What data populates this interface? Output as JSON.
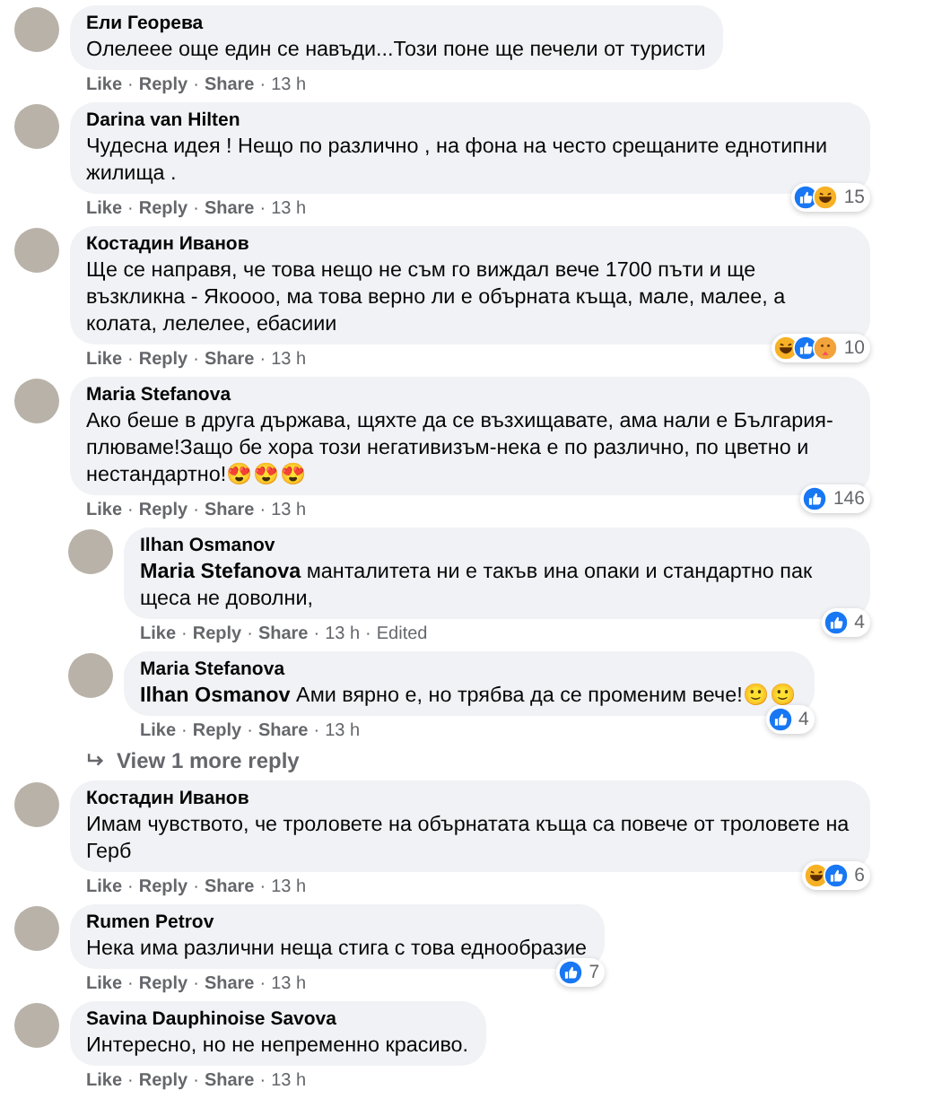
{
  "separator": "·",
  "comments": [
    {
      "author": "Ели Георева",
      "text": "Олелеее още един се навъди...Този поне ще печели от туристи",
      "actions": [
        "Like",
        "Reply",
        "Share"
      ],
      "time": "13 h"
    },
    {
      "author": "Darina van Hilten",
      "text": "Чудесна идея ! Нещо по различно , на фона на често срещаните еднотипни жилища .",
      "actions": [
        "Like",
        "Reply",
        "Share"
      ],
      "time": "13 h",
      "reactions": [
        {
          "kind": "like"
        },
        {
          "kind": "haha"
        }
      ],
      "reaction_count": "15"
    },
    {
      "author": "Костадин Иванов",
      "text": "Ще се направя, че това нещо не съм го виждал вече 1700 пъти и ще възкликна - Якоооо, ма това верно ли е обърната къща, мале, малее, а колата, лелелее, ебасиии",
      "actions": [
        "Like",
        "Reply",
        "Share"
      ],
      "time": "13 h",
      "reactions": [
        {
          "kind": "haha"
        },
        {
          "kind": "like"
        },
        {
          "kind": "care"
        }
      ],
      "reaction_count": "10"
    },
    {
      "author": "Maria Stefanova",
      "text": "Ако беше в друга държава, щяхте да се възхищавате, ама нали е България-плюваме!Защо бе хора този негативизъм-нека е по различно, по цветно и нестандартно!😍😍😍",
      "actions": [
        "Like",
        "Reply",
        "Share"
      ],
      "time": "13 h",
      "reactions": [
        {
          "kind": "like"
        }
      ],
      "reaction_count": "146",
      "replies": [
        {
          "author": "Ilhan Osmanov",
          "text": "**Maria Stefanova** манталитета ни е такъв ина опаки и стандартно пак щеса не доволни,",
          "actions": [
            "Like",
            "Reply",
            "Share"
          ],
          "time": "13 h",
          "edited": "Edited",
          "reactions": [
            {
              "kind": "like"
            }
          ],
          "reaction_count": "4"
        },
        {
          "author": "Maria Stefanova",
          "text": "**Ilhan Osmanov** Ами вярно е, но трябва да се променим вече!🙂🙂",
          "actions": [
            "Like",
            "Reply",
            "Share"
          ],
          "time": "13 h",
          "reactions": [
            {
              "kind": "like"
            }
          ],
          "reaction_count": "4"
        }
      ],
      "more_replies": "View 1 more reply"
    },
    {
      "author": "Костадин Иванов",
      "text": "Имам чувството, че троловете на обърнатата къща са повече от троловете на Герб",
      "actions": [
        "Like",
        "Reply",
        "Share"
      ],
      "time": "13 h",
      "reactions": [
        {
          "kind": "haha"
        },
        {
          "kind": "like"
        }
      ],
      "reaction_count": "6"
    },
    {
      "author": "Rumen Petrov",
      "text": "Нека има различни неща стига с това еднообразие",
      "actions": [
        "Like",
        "Reply",
        "Share"
      ],
      "time": "13 h",
      "reactions": [
        {
          "kind": "like"
        }
      ],
      "reaction_count": "7"
    },
    {
      "author": "Savina Dauphinoise Savova",
      "text": "Интересно, но не непременно красиво.",
      "actions": [
        "Like",
        "Reply",
        "Share"
      ],
      "time": "13 h"
    }
  ]
}
